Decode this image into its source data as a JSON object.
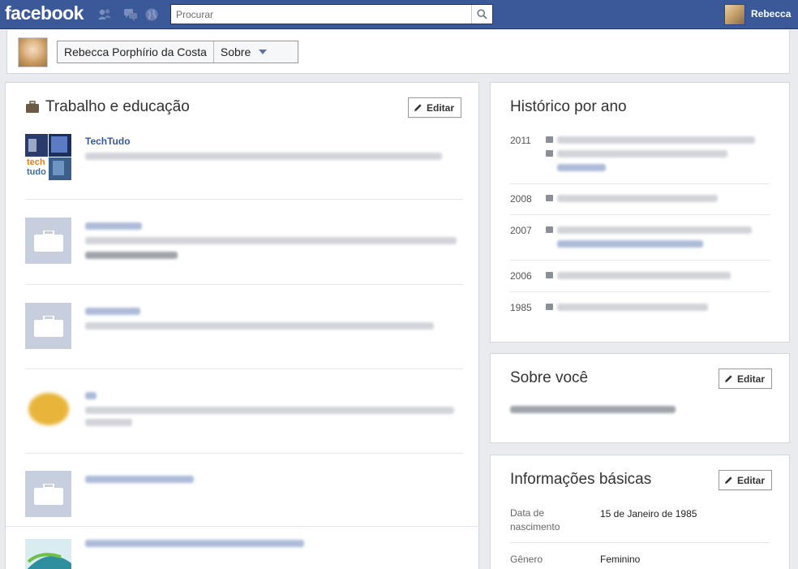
{
  "topbar": {
    "logo": "facebook",
    "search_placeholder": "Procurar",
    "user_name": "Rebecca"
  },
  "header": {
    "profile_name": "Rebecca Porphírio da Costa",
    "section": "Sobre"
  },
  "work": {
    "title": "Trabalho e educação",
    "edit_label": "Editar",
    "entries": [
      {
        "name": "TechTudo",
        "thumb_text": "tech tudo"
      }
    ]
  },
  "history": {
    "title": "Histórico por ano",
    "years": [
      "2011",
      "2008",
      "2007",
      "2006",
      "1985"
    ]
  },
  "about": {
    "title": "Sobre você",
    "edit_label": "Editar"
  },
  "basic": {
    "title": "Informações básicas",
    "edit_label": "Editar",
    "rows": [
      {
        "label": "Data de nascimento",
        "value": "15 de Janeiro de 1985"
      },
      {
        "label": "Gênero",
        "value": "Feminino"
      }
    ]
  },
  "colors": {
    "brand_blue": "#3b5998",
    "page_bg": "#e9ebee",
    "placeholder_thumb": "#c7cedd"
  }
}
